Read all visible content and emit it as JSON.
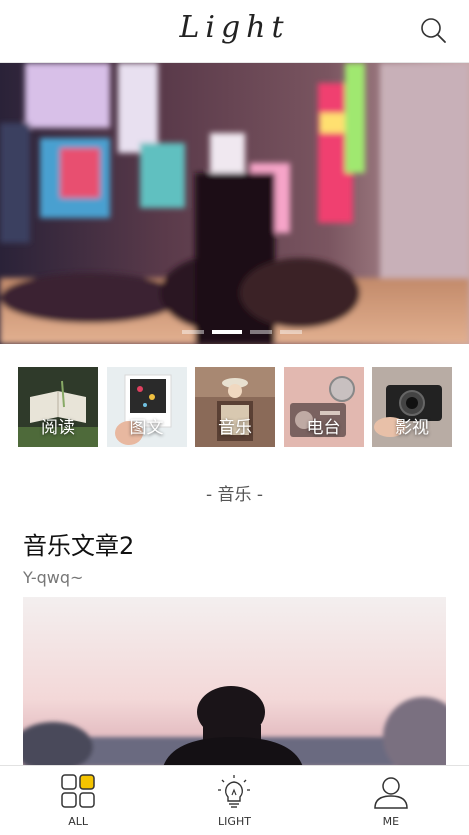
{
  "header": {
    "logo_text": "Light",
    "search_icon": "search-icon"
  },
  "banner": {
    "slide_count": 4,
    "active_slide": 1
  },
  "categories": [
    {
      "label": "阅读",
      "icon": "book-photo"
    },
    {
      "label": "图文",
      "icon": "polaroid-photo"
    },
    {
      "label": "音乐",
      "icon": "accordion-photo"
    },
    {
      "label": "电台",
      "icon": "radio-photo"
    },
    {
      "label": "影视",
      "icon": "camera-photo"
    }
  ],
  "section": {
    "title": "- 音乐 -"
  },
  "article": {
    "title": "音乐文章2",
    "author": "Y-qwq~"
  },
  "bottom_nav": [
    {
      "label": "ALL",
      "icon": "grid-icon"
    },
    {
      "label": "LIGHT",
      "icon": "lightbulb-icon"
    },
    {
      "label": "ME",
      "icon": "user-icon"
    }
  ],
  "colors": {
    "accent": "#f5c400",
    "text": "#111111",
    "muted": "#777777"
  }
}
